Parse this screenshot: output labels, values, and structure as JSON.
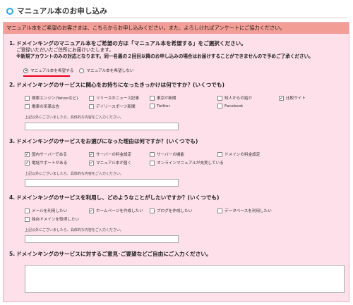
{
  "page": {
    "title": "マニュアル本のお申し込み"
  },
  "notice": "マニュアル本をご希望のお客さまは、こちらからお申し込みください。また、よろしければアンケートにご協力ください。",
  "q1": {
    "number": "1.",
    "text": "ドメインキングのマニュアル本をご希望の方は「マニュアル本を希望する」をご選択ください。",
    "line2": "ご登録いただいたご住所にお届けいたします。",
    "line3": "※新規アカウントのみの対応となります。同一名義の２回目以降のお申し込みの場合はお届けすることができませんので予めご了承ください。",
    "options": [
      "マニュアル本を希望する",
      "マニュアル本を希望しない"
    ]
  },
  "q2": {
    "number": "2.",
    "text": "ドメインキングのサービスに関心をお持ちになったきっかけは何ですか？(いくつでも)",
    "options": [
      "検索エンジン(Yahooなど)",
      "リリースのニュース記事",
      "東京IT新聞",
      "知人からの紹介",
      "比較サイト",
      "電車の吊革広告",
      "デイリースポーツ新聞",
      "Twitter",
      "Facebook"
    ],
    "checked": [
      false,
      false,
      false,
      false,
      true,
      false,
      false,
      false,
      false
    ],
    "hint": "上記以外にございましたら、具体的な内容をご入力ください。"
  },
  "q3": {
    "number": "3.",
    "text": "ドメインキングのサービスをお選びになった理由は何ですか？(いくつでも)",
    "options": [
      "国内サーバーである",
      "サーバーの料金設定",
      "サーバーの機能",
      "ドメインの料金設定",
      "電話サポートがある",
      "マニュアル本が届く",
      "オンラインマニュアルが充実している"
    ],
    "checked": [
      true,
      true,
      false,
      false,
      true,
      true,
      false
    ],
    "hint": "上記以外にございましたら、具体的な内容をご入力ください。"
  },
  "q4": {
    "number": "4.",
    "text": "ドメインキングのサービスを利用し、どのようなことがしたいですか？(いくつでも)",
    "options": [
      "メールを利用したい",
      "ホームページを作成したい",
      "ブログを作成したい",
      "データベースを利用したい",
      "独自ドメインを取得したい"
    ],
    "checked": [
      false,
      true,
      false,
      false,
      false
    ],
    "hint": "上記以外にございましたら、具体的な内容をご入力ください。"
  },
  "q5": {
    "number": "5.",
    "text": "ドメインキングのサービスに対するご意見･ご要望などご自由にご入力ください。"
  },
  "colors": {
    "accent_icon": "#29a8e0",
    "panel_bg": "#fde0ea",
    "notice_bg": "#f29d95",
    "underline": "#e8001a"
  }
}
